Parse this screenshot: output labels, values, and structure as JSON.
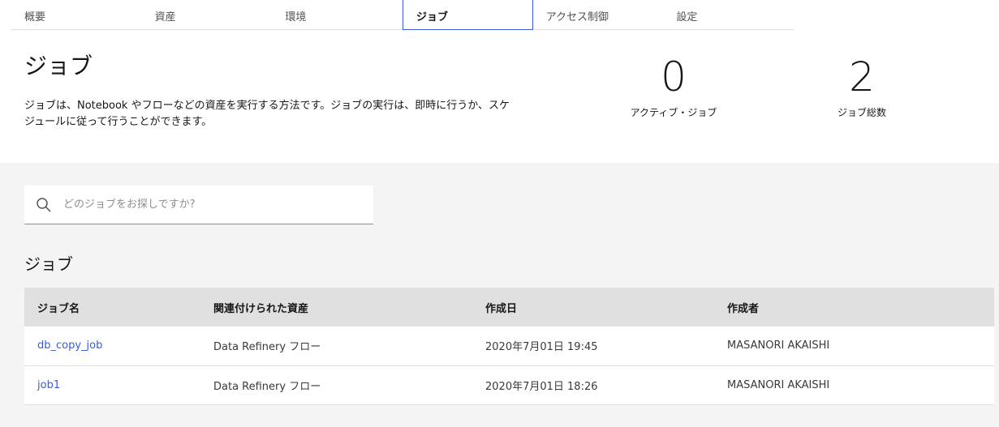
{
  "tabs": [
    {
      "label": "概要"
    },
    {
      "label": "資産"
    },
    {
      "label": "環境"
    },
    {
      "label": "ジョブ"
    },
    {
      "label": "アクセス制御"
    },
    {
      "label": "設定"
    }
  ],
  "header": {
    "title": "ジョブ",
    "description": "ジョブは、Notebook やフローなどの資産を実行する方法です。ジョブの実行は、即時に行うか、スケジュールに従って行うことができます。"
  },
  "stats": {
    "active_jobs": {
      "value": "0",
      "label": "アクティブ・ジョブ"
    },
    "total_jobs": {
      "value": "2",
      "label": "ジョブ総数"
    }
  },
  "search": {
    "placeholder": "どのジョブをお探しですか?",
    "icon": "search-icon"
  },
  "section": {
    "title": "ジョブ"
  },
  "table": {
    "columns": [
      "ジョブ名",
      "関連付けられた資産",
      "作成日",
      "作成者"
    ],
    "rows": [
      {
        "name": "db_copy_job",
        "asset": "Data Refinery フロー",
        "created": "2020年7月01日 19:45",
        "creator": "MASANORI AKAISHI"
      },
      {
        "name": "job1",
        "asset": "Data Refinery フロー",
        "created": "2020年7月01日 18:26",
        "creator": "MASANORI AKAISHI"
      }
    ]
  },
  "colors": {
    "accent": "#3d5bd9",
    "gray_bg": "#f4f4f4",
    "header_bg": "#e0e0e0"
  }
}
